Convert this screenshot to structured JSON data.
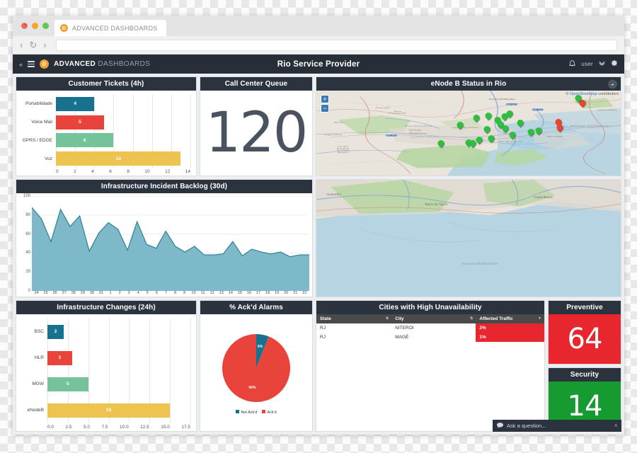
{
  "browser": {
    "tab": {
      "title": "ADVANCED DASHBOARDS",
      "favicon": "D"
    },
    "nav": {
      "back_icon": "‹",
      "reload_icon": "↻",
      "forward_icon": "›",
      "url": ""
    },
    "window_controls": {
      "close": "close-dot",
      "minimize": "minimize-dot",
      "zoom": "zoom-dot"
    }
  },
  "app_header": {
    "collapse_icon": "«",
    "menu_icon": "hamburger",
    "logo_letter": "D",
    "brand_bold": "ADVANCED",
    "brand_light": "DASHBOARDS",
    "title": "Rio Service Provider",
    "bell_icon": "🔔",
    "user_label": "user",
    "user_caret": "ˇˇ",
    "settings_icon": "⚙"
  },
  "panels": {
    "customer_tickets": {
      "title": "Customer Tickets (4h)"
    },
    "call_center": {
      "title": "Call Center Queue",
      "value": "120"
    },
    "backlog": {
      "title": "Infrastructure Incident Backlog (30d)"
    },
    "map": {
      "title": "eNode B Status in Rio",
      "caret_icon": "⌄",
      "attribution_prefix": "© ",
      "attribution_link": "OpenStreetMap",
      "attribution_suffix": " contributors",
      "zoom_in": "+",
      "zoom_out": "−"
    },
    "infra_changes": {
      "title": "Infrastructure Changes (24h)"
    },
    "ack_alarms": {
      "title": "% Ack'd Alarms"
    },
    "cities": {
      "title": "Cities with High Unavailability",
      "columns": [
        "State",
        "City",
        "Affected Traffic"
      ],
      "sort_icon": "⇅",
      "filter_icon": "▼",
      "rows": [
        {
          "state": "RJ",
          "city": "NITEROI",
          "traffic": "2%"
        },
        {
          "state": "RJ",
          "city": "MAGÉ",
          "traffic": "1%"
        }
      ]
    },
    "preventive": {
      "title": "Preventive",
      "value": "64",
      "color": "#e8262d"
    },
    "security": {
      "title": "Security",
      "value": "14",
      "color": "#169b31"
    }
  },
  "ask_bar": {
    "icon": "💬",
    "placeholder": "Ask a question...",
    "caret": "ʌ"
  },
  "chart_data": [
    {
      "type": "bar",
      "orientation": "horizontal",
      "title": "Customer Tickets (4h)",
      "categories": [
        "Portabilidade",
        "Voice Mail",
        "GPRS / EDGE",
        "Voz"
      ],
      "values": [
        4,
        5,
        6,
        13
      ],
      "colors": [
        "#16728f",
        "#e8443c",
        "#74c39a",
        "#eec451"
      ],
      "xlabel": "",
      "ylabel": "",
      "xlim": [
        0,
        14
      ],
      "xticks": [
        0,
        2,
        4,
        6,
        8,
        10,
        12,
        14
      ],
      "grid": true,
      "legend": "none"
    },
    {
      "type": "area",
      "title": "Infrastructure Incident Backlog (30d)",
      "xlabel": "",
      "ylabel": "",
      "ylim": [
        0,
        100
      ],
      "yticks": [
        0,
        20,
        40,
        60,
        80,
        100
      ],
      "grid": true,
      "legend": "none",
      "line_color": "#2e7f97",
      "fill_color": "#7db9c9",
      "categories": [
        "24",
        "25",
        "26",
        "27",
        "28",
        "29",
        "30",
        "31",
        "1",
        "2",
        "3",
        "4",
        "5",
        "6",
        "7",
        "8",
        "9",
        "10",
        "11",
        "12",
        "13",
        "14",
        "15",
        "16",
        "17",
        "18",
        "19",
        "20",
        "21",
        "22"
      ],
      "values": [
        88,
        76,
        52,
        86,
        68,
        79,
        42,
        61,
        72,
        65,
        43,
        73,
        49,
        45,
        63,
        47,
        41,
        47,
        38,
        38,
        39,
        52,
        37,
        44,
        41,
        39,
        41,
        36,
        38,
        38
      ]
    },
    {
      "type": "bar",
      "orientation": "horizontal",
      "title": "Infrastructure Changes (24h)",
      "categories": [
        "BSC",
        "HLR",
        "MGW",
        "eNodeB"
      ],
      "values": [
        2,
        3,
        5,
        15
      ],
      "colors": [
        "#16728f",
        "#e8443c",
        "#74c39a",
        "#eec451"
      ],
      "xlabel": "",
      "ylabel": "",
      "xlim": [
        0,
        17.5
      ],
      "xticks": [
        "0.0",
        "2.5",
        "5.0",
        "7.5",
        "10.0",
        "12.5",
        "15.0",
        "17.5"
      ],
      "grid": true,
      "legend": "none"
    },
    {
      "type": "pie",
      "title": "% Ack'd Alarms",
      "labels": [
        "Not Ack'd",
        "Ack'd"
      ],
      "values": [
        6,
        94
      ],
      "value_labels": [
        "6%",
        "94%"
      ],
      "colors": [
        "#16728f",
        "#e8443c"
      ],
      "legend": "bottom"
    }
  ],
  "map_markers": [
    {
      "x": 47.3,
      "y": 47.5,
      "status": "ok"
    },
    {
      "x": 52.5,
      "y": 39.5,
      "status": "ok"
    },
    {
      "x": 56.5,
      "y": 37.0,
      "status": "ok"
    },
    {
      "x": 59.5,
      "y": 41.5,
      "status": "ok"
    },
    {
      "x": 61.8,
      "y": 37.5,
      "status": "ok"
    },
    {
      "x": 63.5,
      "y": 34.5,
      "status": "ok"
    },
    {
      "x": 56.0,
      "y": 52.5,
      "status": "ok"
    },
    {
      "x": 60.5,
      "y": 47.0,
      "status": "ok"
    },
    {
      "x": 62.0,
      "y": 51.5,
      "status": "ok"
    },
    {
      "x": 67.0,
      "y": 45.0,
      "status": "ok"
    },
    {
      "x": 64.5,
      "y": 59.5,
      "status": "ok"
    },
    {
      "x": 70.5,
      "y": 56.0,
      "status": "ok"
    },
    {
      "x": 73.0,
      "y": 54.0,
      "status": "ok"
    },
    {
      "x": 57.5,
      "y": 63.0,
      "status": "ok"
    },
    {
      "x": 53.5,
      "y": 65.0,
      "status": "ok"
    },
    {
      "x": 50.0,
      "y": 68.0,
      "status": "ok"
    },
    {
      "x": 51.5,
      "y": 69.5,
      "status": "ok"
    },
    {
      "x": 41.0,
      "y": 69.0,
      "status": "ok"
    },
    {
      "x": 79.5,
      "y": 44.5,
      "status": "alarm"
    },
    {
      "x": 80.0,
      "y": 50.5,
      "status": "alarm"
    },
    {
      "x": 87.5,
      "y": 22.0,
      "status": "alarm"
    },
    {
      "x": 86.0,
      "y": 15.5,
      "status": "ok"
    }
  ]
}
